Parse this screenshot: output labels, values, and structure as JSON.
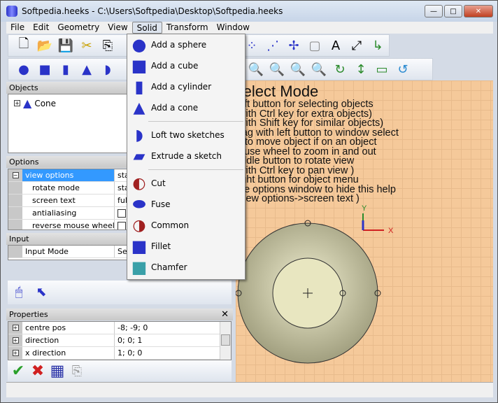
{
  "window": {
    "title": "Softpedia.heeks - C:\\Users\\Softpedia\\Desktop\\Softpedia.heeks",
    "minimize": "—",
    "maximize": "□",
    "close": "✕"
  },
  "menubar": [
    "File",
    "Edit",
    "Geometry",
    "View",
    "Solid",
    "Transform",
    "Window"
  ],
  "solid_menu": [
    {
      "label": "Add a sphere",
      "icon": "sphere-icon"
    },
    {
      "label": "Add a cube",
      "icon": "cube-icon"
    },
    {
      "label": "Add a cylinder",
      "icon": "cylinder-icon"
    },
    {
      "label": "Add a cone",
      "icon": "cone-icon"
    },
    {
      "label": "Loft two sketches",
      "icon": "loft-icon"
    },
    {
      "label": "Extrude a sketch",
      "icon": "extrude-icon"
    },
    {
      "label": "Cut",
      "icon": "cut-icon"
    },
    {
      "label": "Fuse",
      "icon": "fuse-icon"
    },
    {
      "label": "Common",
      "icon": "common-icon"
    },
    {
      "label": "Fillet",
      "icon": "fillet-icon"
    },
    {
      "label": "Chamfer",
      "icon": "chamfer-icon"
    }
  ],
  "objects": {
    "title": "Objects",
    "items": [
      {
        "label": "Cone"
      }
    ]
  },
  "options": {
    "title": "Options",
    "rows": [
      {
        "key": "view options",
        "value": "sta",
        "expand": "−"
      },
      {
        "key": "rotate mode",
        "value": "sta"
      },
      {
        "key": "screen text",
        "value": "full"
      },
      {
        "key": "antialiasing",
        "checkbox": true
      },
      {
        "key": "reverse mouse wheel",
        "checkbox": true
      }
    ]
  },
  "input": {
    "title": "Input",
    "rows": [
      {
        "key": "Input Mode",
        "value": "Sel"
      }
    ]
  },
  "properties": {
    "title": "Properties",
    "close": "✕",
    "rows": [
      {
        "key": "centre pos",
        "value": "-8; -9; 0"
      },
      {
        "key": "direction",
        "value": "0; 0; 1"
      },
      {
        "key": "x direction",
        "value": "1; 0; 0"
      }
    ]
  },
  "viewport": {
    "help_title": "Select Mode",
    "help_lines": [
      "eft button for selecting objects",
      "with Ctrl key for extra objects)",
      "with Shift key for similar objects)",
      "rag with left button to window select",
      "r to move object if on an object",
      "ouse wheel to zoom in and out",
      "iddle button to rotate view",
      "with Ctrl key to pan view )",
      "ight button for object menu",
      "ee options window to hide this help",
      "view options->screen text )"
    ],
    "axis_x": "X",
    "axis_y": "Y",
    "background": "#f5c99a"
  }
}
